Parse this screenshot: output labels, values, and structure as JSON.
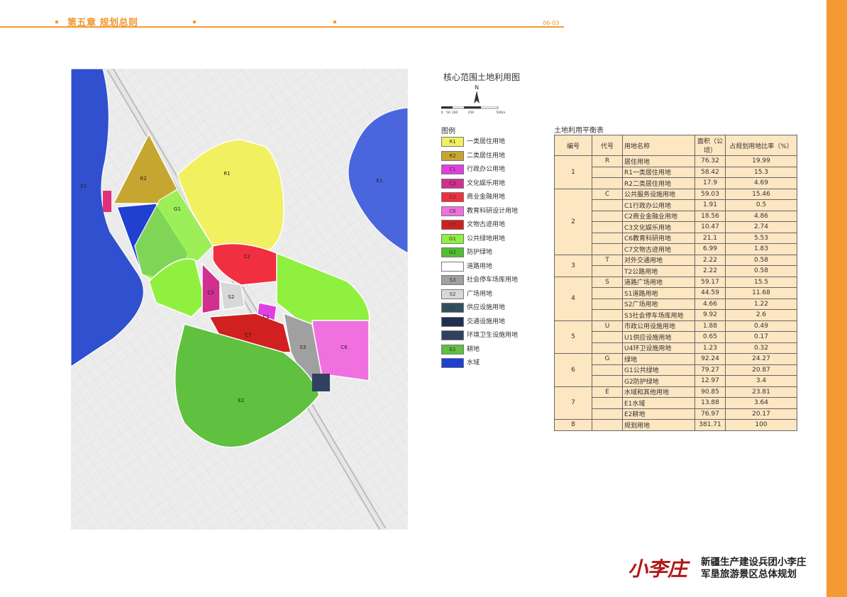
{
  "header": {
    "chapter": "第五章 规划总则",
    "page_no": "06-03"
  },
  "map": {
    "title": "核心范围土地利用图",
    "north_label": "N",
    "scale_labels": [
      "0",
      "50",
      "100",
      "250",
      "500m"
    ],
    "zone_labels": {
      "e1_left": "E1",
      "e1_right": "E1",
      "r1": "R1",
      "r2": "R2",
      "g1": "G1",
      "c2": "C2",
      "c3": "C3",
      "c1": "C1",
      "c6": "C6",
      "c7": "C7",
      "s2": "S2",
      "s3": "S3",
      "e2": "E2"
    }
  },
  "legend": {
    "title": "图例",
    "items": [
      {
        "code": "R1",
        "label": "一类居住用地",
        "color": "#f0f060"
      },
      {
        "code": "R2",
        "label": "二类居住用地",
        "color": "#c6a630"
      },
      {
        "code": "C1",
        "label": "行政办公用地",
        "color": "#e040e0"
      },
      {
        "code": "C3",
        "label": "文化娱乐用地",
        "color": "#d03090"
      },
      {
        "code": "C2",
        "label": "商业金融用地",
        "color": "#f03040"
      },
      {
        "code": "C6",
        "label": "教育科研设计用地",
        "color": "#f070e0"
      },
      {
        "code": "C7",
        "label": "文物古迹用地",
        "color": "#d02020"
      },
      {
        "code": "G1",
        "label": "公共绿地用地",
        "color": "#90f040"
      },
      {
        "code": "G2",
        "label": "防护绿地",
        "color": "#50c030"
      },
      {
        "code": "",
        "label": "道路用地",
        "color": "#ffffff"
      },
      {
        "code": "S3",
        "label": "社会停车场库用地",
        "color": "#a0a0a0"
      },
      {
        "code": "S2",
        "label": "广场用地",
        "color": "#d8d8d8"
      },
      {
        "code": "U1",
        "label": "供应设施用地",
        "color": "#305060"
      },
      {
        "code": "",
        "label": "交通设施用地",
        "color": "#203050"
      },
      {
        "code": "",
        "label": "环境卫生设施用地",
        "color": "#304060"
      },
      {
        "code": "E2",
        "label": "耕地",
        "color": "#60c040"
      },
      {
        "code": "",
        "label": "水域",
        "color": "#2040d0"
      }
    ]
  },
  "table": {
    "title": "土地利用平衡表",
    "headers": [
      "编号",
      "代号",
      "用地名称",
      "面积（公顷）",
      "占规划用地比率（%）"
    ],
    "groups": [
      {
        "no": "1",
        "code": "R",
        "rows": [
          [
            "居住用地",
            "76.32",
            "19.99"
          ],
          [
            "R1一类居住用地",
            "58.42",
            "15.3"
          ],
          [
            "R2二类居住用地",
            "17.9",
            "4.69"
          ]
        ]
      },
      {
        "no": "2",
        "code": "C",
        "rows": [
          [
            "公共服务设施用地",
            "59.03",
            "15.46"
          ],
          [
            "C1行政办公用地",
            "1.91",
            "0.5"
          ],
          [
            "C2商业金融业用地",
            "18.56",
            "4.86"
          ],
          [
            "C3文化娱乐用地",
            "10.47",
            "2.74"
          ],
          [
            "C6教育科研用地",
            "21.1",
            "5.53"
          ],
          [
            "C7文物古迹用地",
            "6.99",
            "1.83"
          ]
        ]
      },
      {
        "no": "3",
        "code": "T",
        "rows": [
          [
            "对外交通用地",
            "2.22",
            "0.58"
          ],
          [
            "T2公路用地",
            "2.22",
            "0.58"
          ]
        ]
      },
      {
        "no": "4",
        "code": "S",
        "rows": [
          [
            "道路广场用地",
            "59.17",
            "15.5"
          ],
          [
            "S1道路用地",
            "44.59",
            "11.68"
          ],
          [
            "S2广场用地",
            "4.66",
            "1.22"
          ],
          [
            "S3社会停车场库用地",
            "9.92",
            "2.6"
          ]
        ]
      },
      {
        "no": "5",
        "code": "U",
        "rows": [
          [
            "市政公用设施用地",
            "1.88",
            "0.49"
          ],
          [
            "U1供应设施用地",
            "0.65",
            "0.17"
          ],
          [
            "U4环卫设施用地",
            "1.23",
            "0.32"
          ]
        ]
      },
      {
        "no": "6",
        "code": "G",
        "rows": [
          [
            "绿地",
            "92.24",
            "24.27"
          ],
          [
            "G1公共绿地",
            "79.27",
            "20.87"
          ],
          [
            "G2防护绿地",
            "12.97",
            "3.4"
          ]
        ]
      },
      {
        "no": "7",
        "code": "E",
        "rows": [
          [
            "水域和其他用地",
            "90.85",
            "23.81"
          ],
          [
            "E1水域",
            "13.88",
            "3.64"
          ],
          [
            "E2耕地",
            "76.97",
            "20.17"
          ]
        ]
      },
      {
        "no": "8",
        "code": "",
        "rows": [
          [
            "规划用地",
            "381.71",
            "100"
          ]
        ]
      }
    ]
  },
  "footer": {
    "logo_text": "小李庄",
    "line1": "新疆生产建设兵团小李庄",
    "line2": "军垦旅游景区总体规划"
  }
}
